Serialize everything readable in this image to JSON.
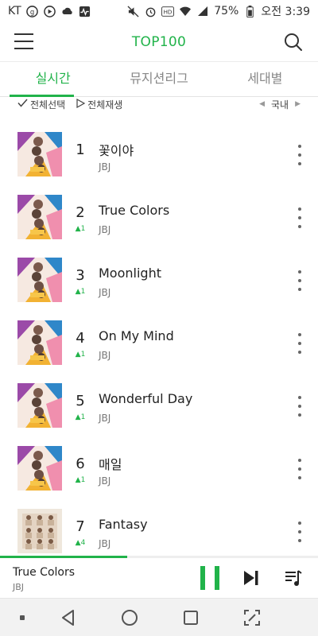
{
  "status_bar": {
    "carrier": "KT",
    "battery": "75%",
    "time": "오전 3:39"
  },
  "header": {
    "title": "TOP100"
  },
  "tabs": [
    {
      "label": "실시간",
      "active": true
    },
    {
      "label": "뮤지션리그",
      "active": false
    },
    {
      "label": "세대별",
      "active": false
    }
  ],
  "controls": {
    "select_all": "전체선택",
    "play_all": "전체재생",
    "region": "국내"
  },
  "chart": [
    {
      "rank": "1",
      "title": "꽃이야",
      "artist": "JBJ",
      "change": "",
      "cover": "album-a"
    },
    {
      "rank": "2",
      "title": "True Colors",
      "artist": "JBJ",
      "change": "▲1",
      "cover": "album-a"
    },
    {
      "rank": "3",
      "title": "Moonlight",
      "artist": "JBJ",
      "change": "▲1",
      "cover": "album-a"
    },
    {
      "rank": "4",
      "title": "On My Mind",
      "artist": "JBJ",
      "change": "▲1",
      "cover": "album-a"
    },
    {
      "rank": "5",
      "title": "Wonderful Day",
      "artist": "JBJ",
      "change": "▲1",
      "cover": "album-a"
    },
    {
      "rank": "6",
      "title": "매일",
      "artist": "JBJ",
      "change": "▲1",
      "cover": "album-a"
    },
    {
      "rank": "7",
      "title": "Fantasy",
      "artist": "JBJ",
      "change": "▲4",
      "cover": "album-b"
    }
  ],
  "now_playing": {
    "title": "True Colors",
    "artist": "JBJ",
    "progress": 0.4
  },
  "colors": {
    "accent": "#21b34a"
  }
}
